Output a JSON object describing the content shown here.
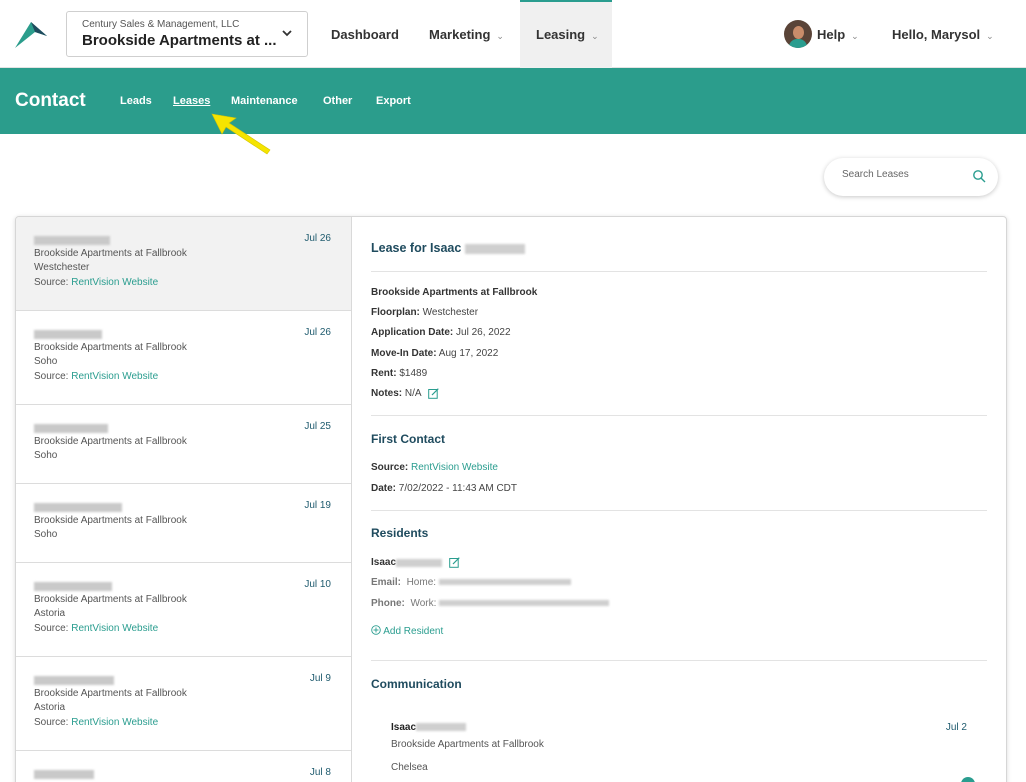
{
  "header": {
    "org_name": "Century Sales & Management, LLC",
    "property_name": "Brookside Apartments at ...",
    "nav": [
      {
        "label": "Dashboard"
      },
      {
        "label": "Marketing"
      },
      {
        "label": "Leasing"
      }
    ],
    "help_label": "Help",
    "user_label": "Hello, Marysol"
  },
  "subnav": {
    "title": "Contact",
    "links": [
      "Leads",
      "Leases",
      "Maintenance",
      "Other",
      "Export"
    ],
    "active": "Leases"
  },
  "search": {
    "placeholder": "Search Leases"
  },
  "leases": [
    {
      "date": "Jul 26",
      "property": "Brookside Apartments at Fallbrook",
      "floorplan": "Westchester",
      "source_prefix": "Source:",
      "source": "RentVision Website"
    },
    {
      "date": "Jul 26",
      "property": "Brookside Apartments at Fallbrook",
      "floorplan": "Soho",
      "source_prefix": "Source:",
      "source": "RentVision Website"
    },
    {
      "date": "Jul 25",
      "property": "Brookside Apartments at Fallbrook",
      "floorplan": "Soho"
    },
    {
      "date": "Jul 19",
      "property": "Brookside Apartments at Fallbrook",
      "floorplan": "Soho"
    },
    {
      "date": "Jul 10",
      "property": "Brookside Apartments at Fallbrook",
      "floorplan": "Astoria",
      "source_prefix": "Source:",
      "source": "RentVision Website"
    },
    {
      "date": "Jul 9",
      "property": "Brookside Apartments at Fallbrook",
      "floorplan": "Astoria",
      "source_prefix": "Source:",
      "source": "RentVision Website"
    },
    {
      "date": "Jul 8"
    }
  ],
  "detail": {
    "title": "Lease for Isaac",
    "property": "Brookside Apartments at Fallbrook",
    "floorplan_label": "Floorplan:",
    "floorplan": "Westchester",
    "application_label": "Application Date:",
    "application_date": "Jul 26, 2022",
    "movein_label": "Move-In Date:",
    "movein_date": "Aug 17, 2022",
    "rent_label": "Rent:",
    "rent": "$1489",
    "notes_label": "Notes:",
    "notes": "N/A",
    "first_contact": {
      "heading": "First Contact",
      "source_label": "Source:",
      "source": "RentVision Website",
      "date_label": "Date:",
      "date": "7/02/2022 - 11:43 AM CDT"
    },
    "residents": {
      "heading": "Residents",
      "name": "Isaac",
      "email_label": "Email:",
      "email_type": "Home:",
      "phone_label": "Phone:",
      "phone_type": "Work:",
      "add_label": "Add Resident"
    },
    "communication": {
      "heading": "Communication",
      "name": "Isaac",
      "date": "Jul 2",
      "property": "Brookside Apartments at Fallbrook",
      "floorplan": "Chelsea"
    }
  },
  "colors": {
    "teal": "#2b9d8c",
    "navy": "#1f4b5e",
    "arrow": "#f5e400"
  }
}
